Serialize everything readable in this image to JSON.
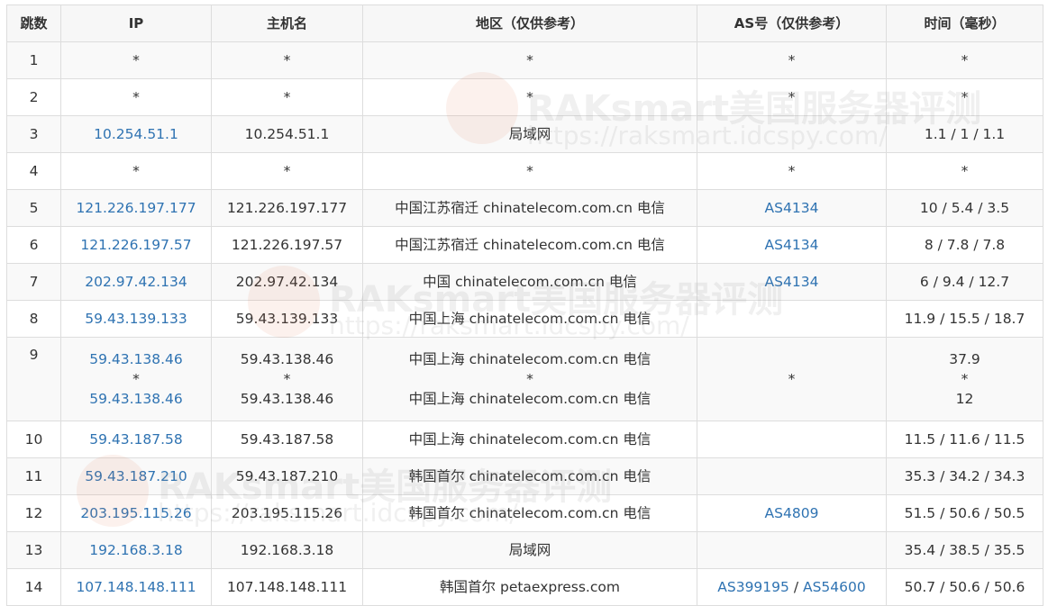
{
  "columns": [
    "跳数",
    "IP",
    "主机名",
    "地区（仅供参考）",
    "AS号（仅供参考）",
    "时间（毫秒）"
  ],
  "watermark": {
    "brand": "RAKsmart美国服务器评测",
    "url": "https://raksmart.idcspy.com/"
  },
  "rows": [
    {
      "hop": "1",
      "ip": [
        "*"
      ],
      "host": [
        "*"
      ],
      "region": [
        "*"
      ],
      "as": [],
      "as_plain": "*",
      "time": [
        "*"
      ]
    },
    {
      "hop": "2",
      "ip": [
        "*"
      ],
      "host": [
        "*"
      ],
      "region": [
        "*"
      ],
      "as": [],
      "as_plain": "*",
      "time": [
        "*"
      ]
    },
    {
      "hop": "3",
      "ip": [
        "10.254.51.1"
      ],
      "host": [
        "10.254.51.1"
      ],
      "region": [
        "局域网"
      ],
      "as": [],
      "as_plain": "",
      "time": [
        "1.1 / 1 / 1.1"
      ]
    },
    {
      "hop": "4",
      "ip": [
        "*"
      ],
      "host": [
        "*"
      ],
      "region": [
        "*"
      ],
      "as": [],
      "as_plain": "*",
      "time": [
        "*"
      ]
    },
    {
      "hop": "5",
      "ip": [
        "121.226.197.177"
      ],
      "host": [
        "121.226.197.177"
      ],
      "region": [
        "中国江苏宿迁 chinatelecom.com.cn 电信"
      ],
      "as": [
        "AS4134"
      ],
      "as_plain": "",
      "time": [
        "10 / 5.4 / 3.5"
      ]
    },
    {
      "hop": "6",
      "ip": [
        "121.226.197.57"
      ],
      "host": [
        "121.226.197.57"
      ],
      "region": [
        "中国江苏宿迁 chinatelecom.com.cn 电信"
      ],
      "as": [
        "AS4134"
      ],
      "as_plain": "",
      "time": [
        "8 / 7.8 / 7.8"
      ]
    },
    {
      "hop": "7",
      "ip": [
        "202.97.42.134"
      ],
      "host": [
        "202.97.42.134"
      ],
      "region": [
        "中国 chinatelecom.com.cn 电信"
      ],
      "as": [
        "AS4134"
      ],
      "as_plain": "",
      "time": [
        "6 / 9.4 / 12.7"
      ]
    },
    {
      "hop": "8",
      "ip": [
        "59.43.139.133"
      ],
      "host": [
        "59.43.139.133"
      ],
      "region": [
        "中国上海 chinatelecom.com.cn 电信"
      ],
      "as": [],
      "as_plain": "",
      "time": [
        "11.9 / 15.5 / 18.7"
      ]
    },
    {
      "hop": "9",
      "ip": [
        "59.43.138.46",
        "*",
        "59.43.138.46"
      ],
      "host": [
        "59.43.138.46",
        "*",
        "59.43.138.46"
      ],
      "region": [
        "中国上海 chinatelecom.com.cn 电信",
        "*",
        "中国上海 chinatelecom.com.cn 电信"
      ],
      "as": [],
      "as_plain": "*",
      "time": [
        "37.9",
        "*",
        "12"
      ]
    },
    {
      "hop": "10",
      "ip": [
        "59.43.187.58"
      ],
      "host": [
        "59.43.187.58"
      ],
      "region": [
        "中国上海 chinatelecom.com.cn 电信"
      ],
      "as": [],
      "as_plain": "",
      "time": [
        "11.5 / 11.6 / 11.5"
      ]
    },
    {
      "hop": "11",
      "ip": [
        "59.43.187.210"
      ],
      "host": [
        "59.43.187.210"
      ],
      "region": [
        "韩国首尔 chinatelecom.com.cn 电信"
      ],
      "as": [],
      "as_plain": "",
      "time": [
        "35.3 / 34.2 / 34.3"
      ]
    },
    {
      "hop": "12",
      "ip": [
        "203.195.115.26"
      ],
      "host": [
        "203.195.115.26"
      ],
      "region": [
        "韩国首尔 chinatelecom.com.cn 电信"
      ],
      "as": [
        "AS4809"
      ],
      "as_plain": "",
      "time": [
        "51.5 / 50.6 / 50.5"
      ]
    },
    {
      "hop": "13",
      "ip": [
        "192.168.3.18"
      ],
      "host": [
        "192.168.3.18"
      ],
      "region": [
        "局域网"
      ],
      "as": [],
      "as_plain": "",
      "time": [
        "35.4 / 38.5 / 35.5"
      ]
    },
    {
      "hop": "14",
      "ip": [
        "107.148.148.111"
      ],
      "host": [
        "107.148.148.111"
      ],
      "region": [
        "韩国首尔 petaexpress.com"
      ],
      "as": [
        "AS399195",
        "AS54600"
      ],
      "as_plain": "",
      "time": [
        "50.7 / 50.6 / 50.6"
      ]
    }
  ]
}
